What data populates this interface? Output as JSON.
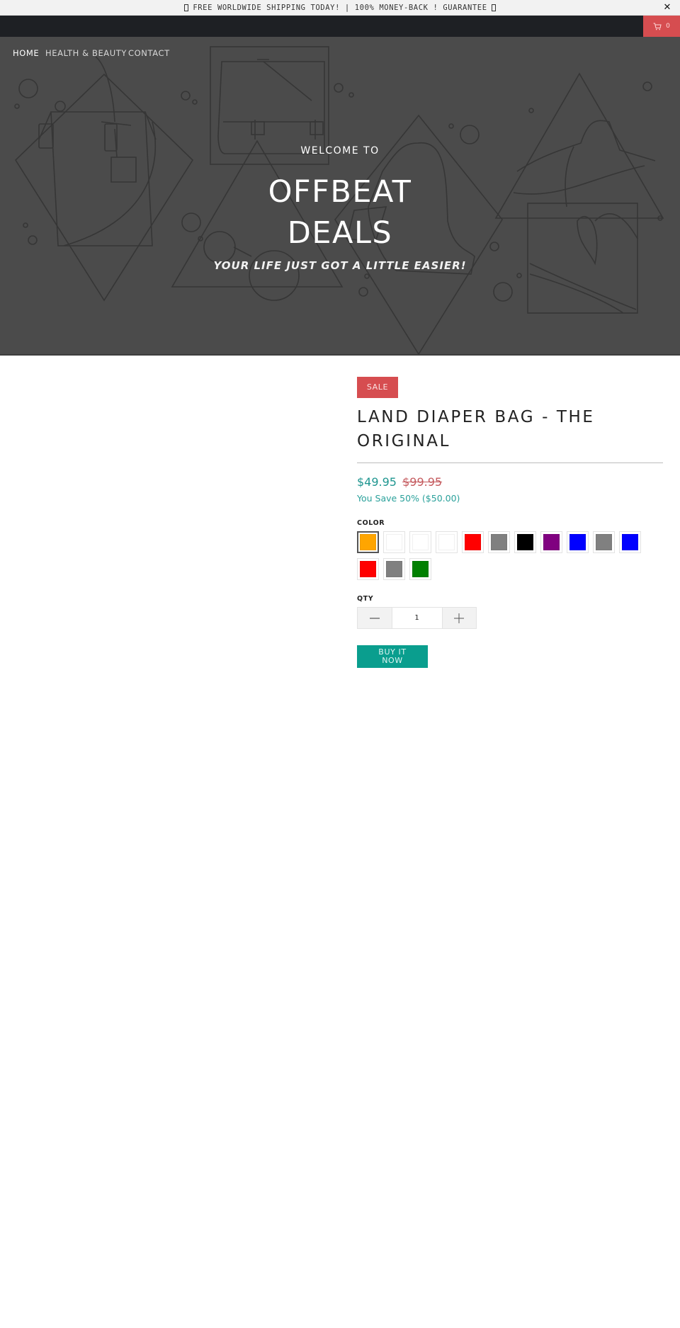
{
  "announcement": {
    "text": "FREE WORLDWIDE SHIPPING TODAY! | 100% MONEY-BACK ! GUARANTEE",
    "close_label": "✕"
  },
  "header": {
    "cart_count": "0",
    "nav": [
      {
        "label": "HOME"
      },
      {
        "label": "HEALTH & BEAUTY"
      },
      {
        "label": "CONTACT"
      }
    ]
  },
  "hero": {
    "welcome": "WELCOME TO",
    "title_line1": "OFFBEAT",
    "title_line2": "DEALS",
    "tagline": "YOUR LIFE JUST GOT A LITTLE EASIER!"
  },
  "product": {
    "badge": "SALE",
    "title": "LAND DIAPER BAG - THE ORIGINAL",
    "price": "$49.95",
    "compare_price": "$99.95",
    "savings": "You Save 50% ($50.00)",
    "color_label": "COLOR",
    "colors": [
      {
        "name": "orange",
        "hex": "#FFA500",
        "selected": true
      },
      {
        "name": "white",
        "hex": "#FFFFFF"
      },
      {
        "name": "white",
        "hex": "#FFFFFF"
      },
      {
        "name": "white",
        "hex": "#FFFFFF"
      },
      {
        "name": "red",
        "hex": "#FF0000"
      },
      {
        "name": "gray",
        "hex": "#808080"
      },
      {
        "name": "black",
        "hex": "#000000"
      },
      {
        "name": "purple",
        "hex": "#800080"
      },
      {
        "name": "blue",
        "hex": "#0000FF"
      },
      {
        "name": "gray",
        "hex": "#808080"
      },
      {
        "name": "blue",
        "hex": "#0000FF"
      },
      {
        "name": "red",
        "hex": "#FF0000"
      },
      {
        "name": "gray",
        "hex": "#808080"
      },
      {
        "name": "green",
        "hex": "#008000"
      }
    ],
    "qty_label": "QTY",
    "qty_value": "1",
    "buy_label": "BUY IT NOW"
  },
  "theme": {
    "accent_red": "#D64D50",
    "accent_teal": "#0A9E8E",
    "hero_bg": "#4B4B4B",
    "topbar_bg": "#1E2024"
  }
}
